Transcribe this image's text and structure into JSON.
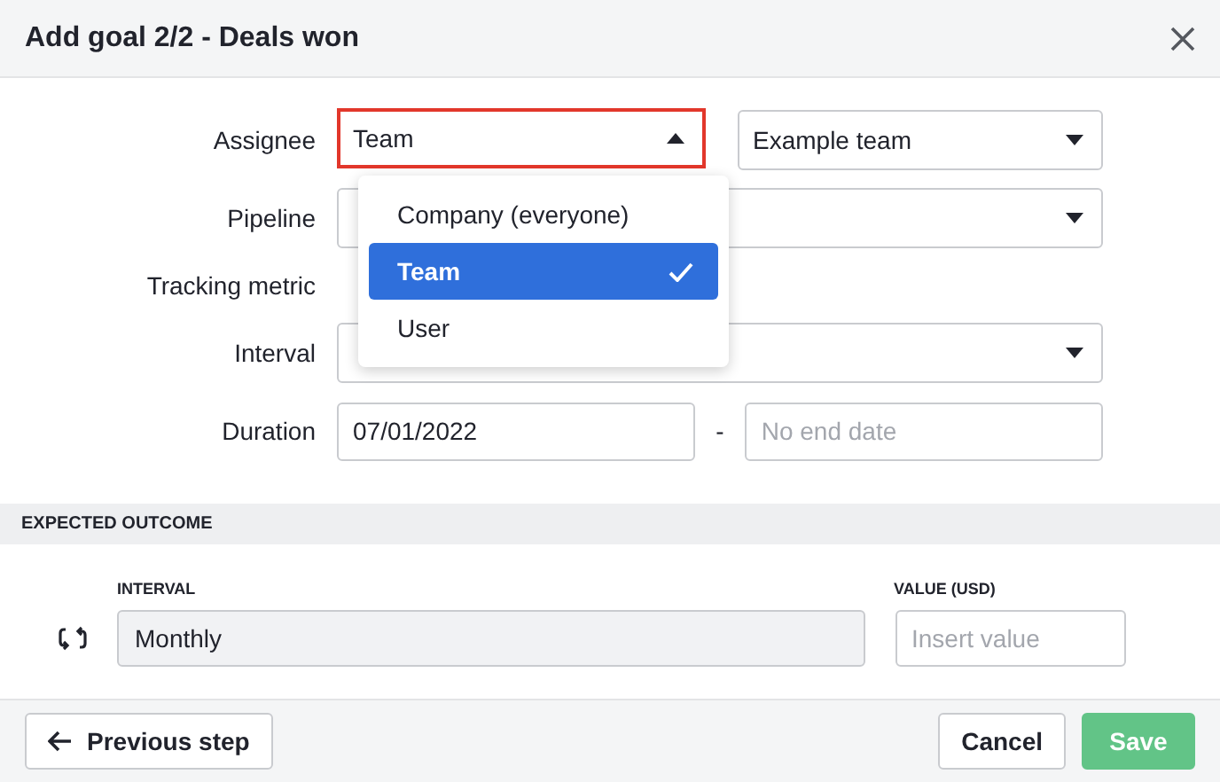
{
  "dialog": {
    "title": "Add goal 2/2 - Deals won"
  },
  "form": {
    "rows": [
      {
        "label": "Assignee",
        "kind": "assignee",
        "fields": [
          {
            "kind": "select",
            "value": "Team",
            "focused": true,
            "open": true
          },
          {
            "kind": "select",
            "value": "Example team",
            "focused": false,
            "open": false
          }
        ]
      },
      {
        "label": "Pipeline",
        "kind": "select",
        "fields": [
          {
            "kind": "select",
            "focused": false,
            "open": false
          }
        ]
      },
      {
        "label": "Tracking metric",
        "kind": "empty",
        "fields": []
      },
      {
        "label": "Interval",
        "kind": "select",
        "fields": [
          {
            "kind": "select",
            "focused": false,
            "open": false
          }
        ]
      },
      {
        "label": "Duration",
        "kind": "range",
        "separator": "-",
        "fields": [
          {
            "kind": "text",
            "value": "07/01/2022"
          },
          {
            "kind": "text",
            "placeholder": "No end date"
          }
        ]
      }
    ]
  },
  "dropdown": {
    "options": [
      {
        "label": "Company (everyone)",
        "selected": false
      },
      {
        "label": "Team",
        "selected": true
      },
      {
        "label": "User",
        "selected": false
      }
    ]
  },
  "expected_outcome": {
    "heading": "EXPECTED OUTCOME",
    "interval_label": "INTERVAL",
    "value_label": "VALUE (USD)",
    "interval_value": "Monthly",
    "value_placeholder": "Insert value"
  },
  "footer": {
    "back_button": "Previous step",
    "buttons": [
      {
        "label": "Cancel",
        "kind": "secondary",
        "disabled": false
      },
      {
        "label": "Save",
        "kind": "primary",
        "disabled": true
      }
    ]
  }
}
